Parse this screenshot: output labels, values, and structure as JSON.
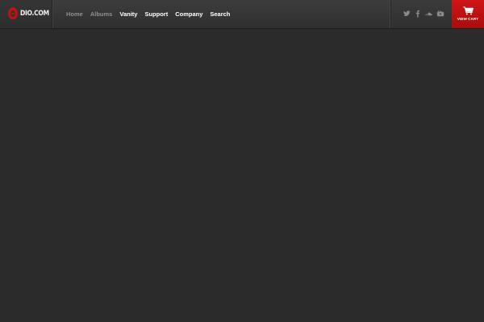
{
  "brand": {
    "logo_text": "DIO.COM",
    "accent_color": "#c41212"
  },
  "nav": {
    "items": [
      {
        "label": "Home"
      },
      {
        "label": "Albums"
      },
      {
        "label": "Vanity"
      },
      {
        "label": "Support"
      },
      {
        "label": "Company"
      },
      {
        "label": "Search"
      }
    ]
  },
  "social": {
    "icons": [
      "twitter-icon",
      "facebook-icon",
      "soundcloud-icon",
      "youtube-icon"
    ]
  },
  "cart": {
    "label": "VIEW CART",
    "icon": "shopping-cart-icon"
  }
}
